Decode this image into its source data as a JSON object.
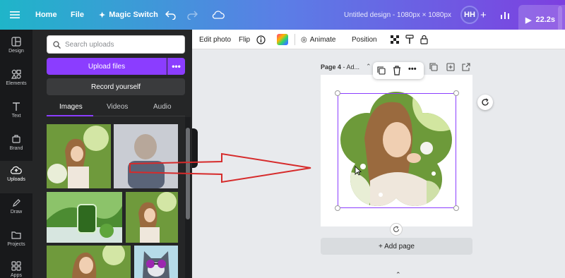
{
  "topbar": {
    "home": "Home",
    "file": "File",
    "magic_switch": "Magic Switch",
    "design_title": "Untitled design - 1080px × 1080px",
    "avatar_initials": "HH",
    "play_duration": "22.2s"
  },
  "rail": {
    "items": [
      {
        "label": "Design",
        "icon": "design-icon"
      },
      {
        "label": "Elements",
        "icon": "elements-icon"
      },
      {
        "label": "Text",
        "icon": "text-icon"
      },
      {
        "label": "Brand",
        "icon": "brand-icon"
      },
      {
        "label": "Uploads",
        "icon": "uploads-icon"
      },
      {
        "label": "Draw",
        "icon": "draw-icon"
      },
      {
        "label": "Projects",
        "icon": "projects-icon"
      },
      {
        "label": "Apps",
        "icon": "apps-icon"
      }
    ],
    "active": "Uploads"
  },
  "uploads": {
    "search_placeholder": "Search uploads",
    "upload_files": "Upload files",
    "more": "•••",
    "record_yourself": "Record yourself",
    "tabs": [
      "Images",
      "Videos",
      "Audio"
    ],
    "active_tab": "Images"
  },
  "toolbar": {
    "edit_photo": "Edit photo",
    "flip": "Flip",
    "animate": "Animate",
    "position": "Position"
  },
  "canvas": {
    "page_label_bold": "Page 4",
    "page_label_rest": " - Ad...",
    "add_page": "+ Add page"
  },
  "colors": {
    "accent": "#8b3dff",
    "panel_bg": "#252627",
    "rail_bg": "#18191b",
    "arrow": "#d62b2b"
  }
}
